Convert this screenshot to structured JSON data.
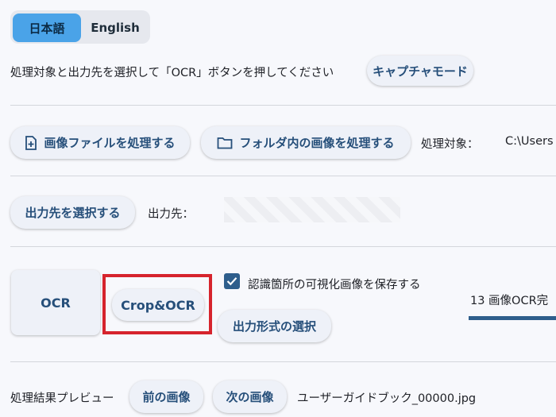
{
  "lang": {
    "ja": "日本語",
    "en": "English"
  },
  "instruction": "処理対象と出力先を選択して「OCR」ボタンを押してください",
  "capture_mode": "キャプチャモード",
  "process_image_file": "画像ファイルを処理する",
  "process_folder": "フォルダ内の画像を処理する",
  "target_label": "処理対象：",
  "target_value": "C:\\Users",
  "select_output": "出力先を選択する",
  "output_label": "出力先：",
  "ocr_button": "OCR",
  "crop_ocr_button": "Crop&OCR",
  "save_visualization": "認識箇所の可視化画像を保存する",
  "select_format": "出力形式の選択",
  "status": "13 画像OCR完",
  "preview_label": "処理結果プレビュー",
  "prev_image": "前の画像",
  "next_image": "次の画像",
  "filename": "ユーザーガイドブック_00000.jpg",
  "colors": {
    "accent": "#4aa3e8",
    "button_text": "#264f7a",
    "highlight": "#d6242d",
    "checkbox": "#2e5e8c"
  }
}
